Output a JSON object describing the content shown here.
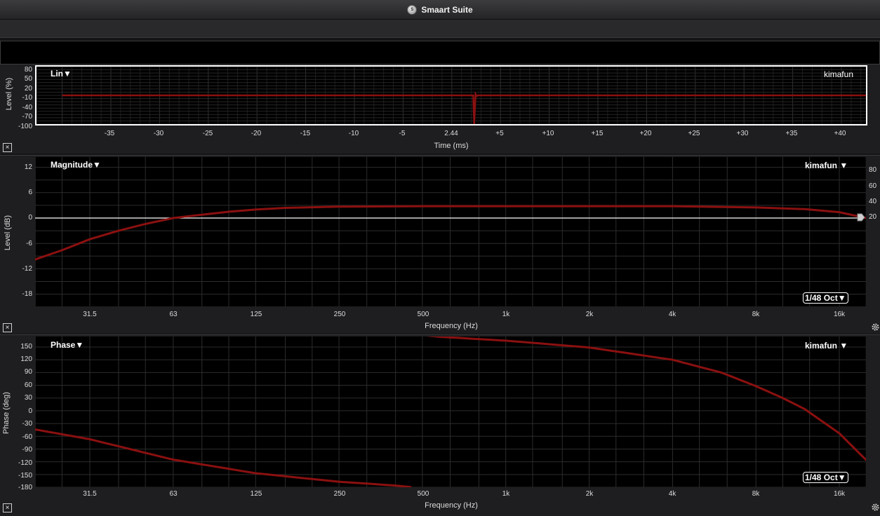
{
  "window": {
    "title": "Smaart Suite",
    "logo_icon": "smaart-logo-icon",
    "logo_text": "S"
  },
  "impulse": {
    "label": "Lin▼",
    "trace_name": "kimafun",
    "y_axis_label": "Level (%)",
    "x_axis_label": "Time (ms)",
    "y_ticks": [
      "80",
      "50",
      "20",
      "-10",
      "-40",
      "-70",
      "-100"
    ],
    "x_ticks": [
      "-35",
      "-30",
      "-25",
      "-20",
      "-15",
      "-10",
      "-5",
      "2.44",
      "+5",
      "+10",
      "+15",
      "+20",
      "+25",
      "+30",
      "+35",
      "+40"
    ]
  },
  "magnitude": {
    "label": "Magnitude▼",
    "trace_name": "kimafun ▼",
    "y_axis_label": "Level (dB)",
    "x_axis_label": "Frequency (Hz)",
    "y_ticks": [
      "12",
      "6",
      "0",
      "-6",
      "-12",
      "-18"
    ],
    "y_ticks_right": [
      "80",
      "60",
      "40",
      "20"
    ],
    "x_ticks": [
      "31.5",
      "63",
      "125",
      "250",
      "500",
      "1k",
      "2k",
      "4k",
      "8k",
      "16k"
    ],
    "smoothing": "1/48 Oct▼"
  },
  "phase": {
    "label": "Phase▼",
    "trace_name": "kimafun ▼",
    "y_axis_label": "Phase (deg)",
    "x_axis_label": "Frequency (Hz)",
    "y_ticks": [
      "150",
      "120",
      "90",
      "60",
      "30",
      "0",
      "-30",
      "-60",
      "-90",
      "-120",
      "-150",
      "-180"
    ],
    "x_ticks": [
      "31.5",
      "63",
      "125",
      "250",
      "500",
      "1k",
      "2k",
      "4k",
      "8k",
      "16k"
    ],
    "smoothing": "1/48 Oct▼"
  },
  "colors": {
    "trace": "#8b1010",
    "grid": "#2c2c2c",
    "zero_line": "#ffffff"
  },
  "icons": {
    "close": "close-icon",
    "settings": "gear-icon"
  },
  "chart_data": [
    {
      "type": "line",
      "title": "",
      "label": "Lin",
      "xlabel": "Time (ms)",
      "ylabel": "Level (%)",
      "xlim": [
        -40,
        43
      ],
      "ylim": [
        -100,
        80
      ],
      "x_ticks": [
        -35,
        -30,
        -25,
        -20,
        -15,
        -10,
        -5,
        2.44,
        5,
        10,
        15,
        20,
        25,
        30,
        35,
        40
      ],
      "y_ticks": [
        80,
        50,
        20,
        -10,
        -40,
        -70,
        -100
      ],
      "series": [
        {
          "name": "kimafun",
          "x": [
            -40,
            2.2,
            2.3,
            2.44,
            2.55,
            2.7,
            43
          ],
          "y": [
            -10,
            -10,
            -100,
            -6,
            -12,
            -10,
            -10
          ]
        }
      ]
    },
    {
      "type": "line",
      "title": "",
      "label": "Magnitude",
      "xlabel": "Frequency (Hz)",
      "ylabel": "Level (dB)",
      "xscale": "log",
      "xlim": [
        20,
        20000
      ],
      "ylim": [
        -21,
        13.5
      ],
      "x_ticks": [
        31.5,
        63,
        125,
        250,
        500,
        1000,
        2000,
        4000,
        8000,
        16000
      ],
      "y_ticks": [
        12,
        6,
        0,
        -6,
        -12,
        -18
      ],
      "y2_ticks": [
        80,
        60,
        40,
        20
      ],
      "smoothing": "1/48 Oct",
      "series": [
        {
          "name": "kimafun",
          "x": [
            20,
            25,
            31.5,
            40,
            50,
            63,
            80,
            100,
            125,
            160,
            250,
            500,
            1000,
            2000,
            4000,
            8000,
            12000,
            16000,
            20000
          ],
          "y": [
            -9.8,
            -7.6,
            -5.0,
            -3.0,
            -1.4,
            0.0,
            0.8,
            1.5,
            2.0,
            2.4,
            2.7,
            2.8,
            2.8,
            2.8,
            2.8,
            2.5,
            2.1,
            1.4,
            0.0
          ]
        }
      ]
    },
    {
      "type": "line",
      "title": "",
      "label": "Phase",
      "xlabel": "Frequency (Hz)",
      "ylabel": "Phase (deg)",
      "xscale": "log",
      "xlim": [
        20,
        20000
      ],
      "ylim": [
        -180,
        168
      ],
      "x_ticks": [
        31.5,
        63,
        125,
        250,
        500,
        1000,
        2000,
        4000,
        8000,
        16000
      ],
      "y_ticks": [
        150,
        120,
        90,
        60,
        30,
        0,
        -30,
        -60,
        -90,
        -120,
        -150,
        -180
      ],
      "smoothing": "1/48 Oct",
      "series": [
        {
          "name": "kimafun",
          "wrapped": true,
          "x": [
            20,
            31.5,
            63,
            125,
            250,
            400,
            580,
            1000,
            2000,
            4000,
            6000,
            8000,
            10000,
            12000,
            16000,
            20000
          ],
          "y": [
            -44,
            -67,
            -115,
            -147,
            -167,
            -176,
            -186,
            -195,
            -211,
            -240,
            -270,
            -302,
            -330,
            -356,
            -413,
            -476
          ]
        }
      ]
    }
  ]
}
